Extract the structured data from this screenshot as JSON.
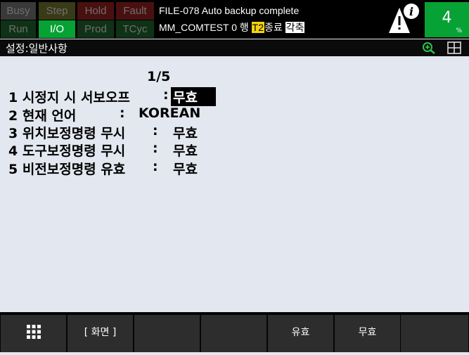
{
  "status": {
    "busy": "Busy",
    "step": "Step",
    "hold": "Hold",
    "fault": "Fault",
    "run": "Run",
    "io": "I/O",
    "prod": "Prod",
    "tcyc": "TCyc"
  },
  "message": {
    "line1": "FILE-078 Auto backup complete",
    "line2_prefix": "MM_COMTEST 0 행 ",
    "line2_t2": "T2",
    "line2_mid": "종료 ",
    "line2_kak": "각축"
  },
  "override": {
    "value": "4",
    "unit": "%"
  },
  "screen": {
    "title": "설정:일반사항",
    "page": "1/5"
  },
  "settings": [
    {
      "label": "1 시정지 시 서보오프",
      "colon": ":",
      "value": "무효"
    },
    {
      "label": "2 현재 언어",
      "colon": ":",
      "value": "KOREAN"
    },
    {
      "label": "3 위치보정명령 무시",
      "colon": ":",
      "value": "무효"
    },
    {
      "label": "4 도구보정명령 무시",
      "colon": ":",
      "value": "무효"
    },
    {
      "label": "5 비전보정명령 유효",
      "colon": ":",
      "value": "무효"
    }
  ],
  "function_keys": [
    "",
    "[ 화면 ]",
    "",
    "",
    "유효",
    "무효",
    ""
  ],
  "colors": {
    "accent_green": "#07a235",
    "t2_yellow": "#f6d40c"
  }
}
